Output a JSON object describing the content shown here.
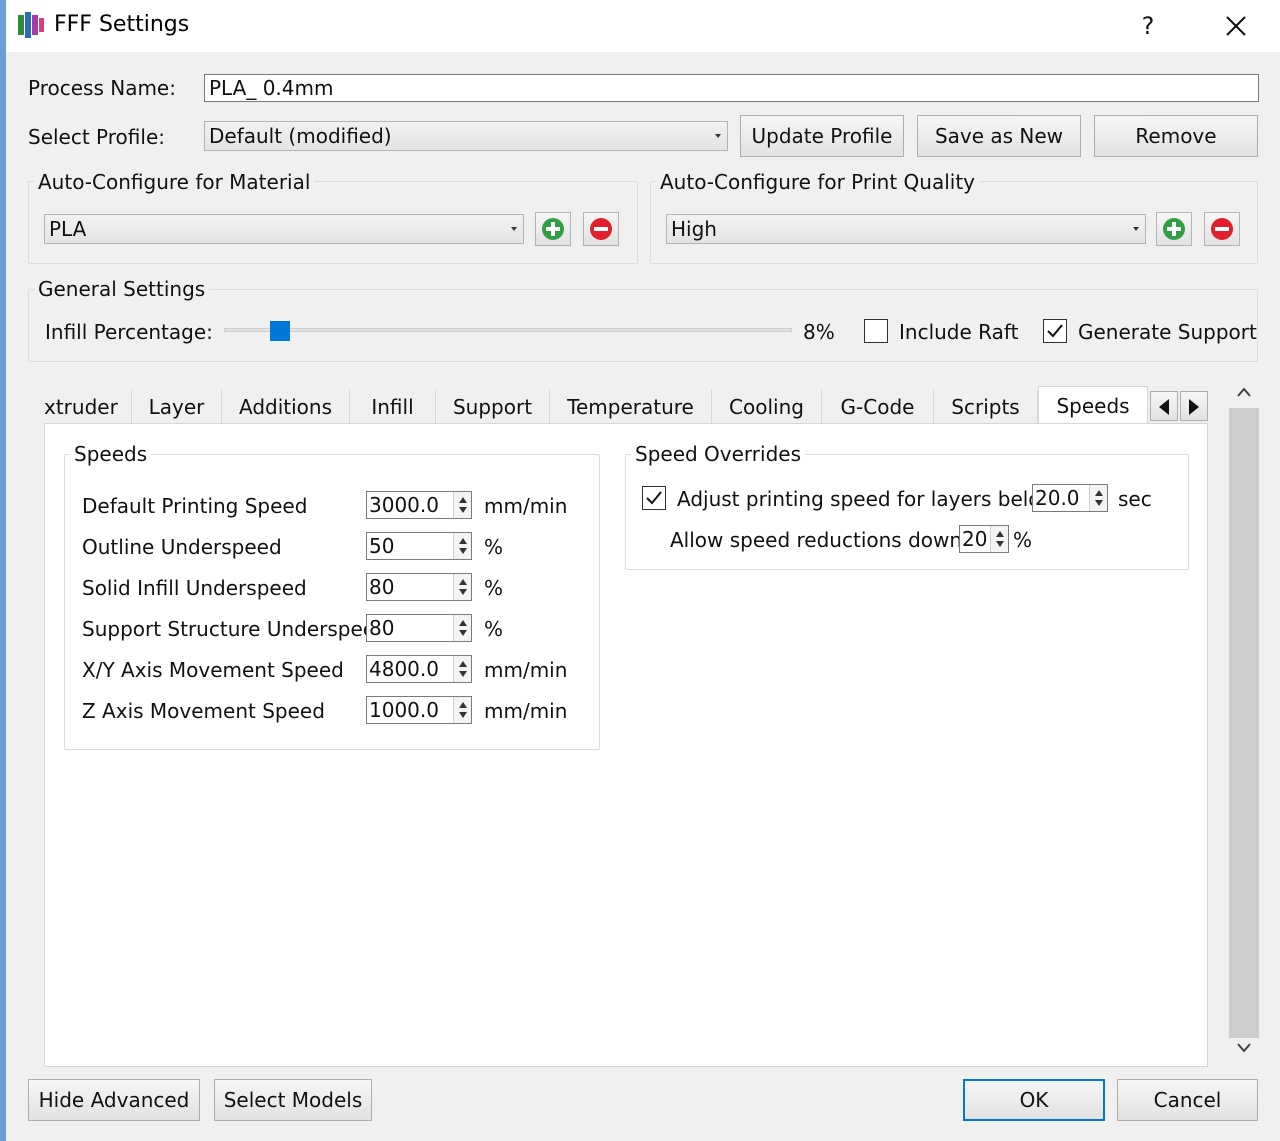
{
  "window": {
    "title": "FFF Settings",
    "help_label": "?"
  },
  "process": {
    "name_label": "Process Name:",
    "name_value": "PLA_ 0.4mm",
    "profile_label": "Select Profile:",
    "profile_value": "Default (modified)",
    "update_label": "Update Profile",
    "save_new_label": "Save as New",
    "remove_label": "Remove"
  },
  "material": {
    "group_title": "Auto-Configure for Material",
    "value": "PLA"
  },
  "quality": {
    "group_title": "Auto-Configure for Print Quality",
    "value": "High"
  },
  "general": {
    "group_title": "General Settings",
    "infill_label": "Infill Percentage:",
    "infill_value": "8%",
    "infill_fraction": 0.08,
    "raft_label": "Include Raft",
    "raft_checked": false,
    "support_label": "Generate Support",
    "support_checked": true
  },
  "tabs": [
    {
      "label": "xtruder"
    },
    {
      "label": "Layer"
    },
    {
      "label": "Additions"
    },
    {
      "label": "Infill"
    },
    {
      "label": "Support"
    },
    {
      "label": "Temperature"
    },
    {
      "label": "Cooling"
    },
    {
      "label": "G-Code"
    },
    {
      "label": "Scripts"
    },
    {
      "label": "Speeds"
    }
  ],
  "active_tab": "Speeds",
  "speeds": {
    "group_title": "Speeds",
    "rows": [
      {
        "label": "Default Printing Speed",
        "value": "3000.0",
        "unit": "mm/min"
      },
      {
        "label": "Outline Underspeed",
        "value": "50",
        "unit": "%"
      },
      {
        "label": "Solid Infill Underspeed",
        "value": "80",
        "unit": "%"
      },
      {
        "label": "Support Structure Underspeed",
        "value": "80",
        "unit": "%"
      },
      {
        "label": "X/Y Axis Movement Speed",
        "value": "4800.0",
        "unit": "mm/min"
      },
      {
        "label": "Z Axis Movement Speed",
        "value": "1000.0",
        "unit": "mm/min"
      }
    ]
  },
  "overrides": {
    "group_title": "Speed Overrides",
    "adjust_label": "Adjust printing speed for layers below",
    "adjust_checked": true,
    "adjust_value": "20.0",
    "adjust_unit": "sec",
    "reduce_label": "Allow speed reductions down to",
    "reduce_value": "20",
    "reduce_unit": "%"
  },
  "footer": {
    "hide_advanced_label": "Hide Advanced",
    "select_models_label": "Select Models",
    "ok_label": "OK",
    "cancel_label": "Cancel"
  },
  "colors": {
    "accent": "#0078d7",
    "add_green": "#2ea043",
    "remove_red": "#e0202a"
  }
}
